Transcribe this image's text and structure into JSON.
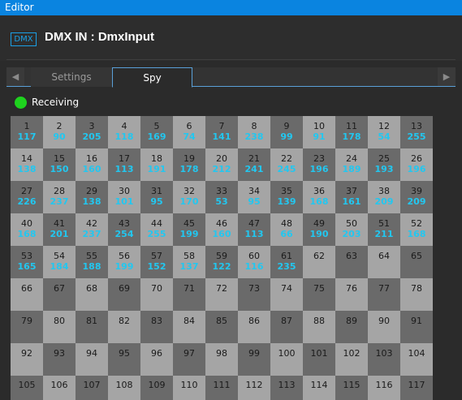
{
  "window": {
    "title": "Editor"
  },
  "header": {
    "badge": "DMX",
    "title": "DMX IN : DmxInput"
  },
  "tabs": {
    "left_arrow": "◀",
    "right_arrow": "▶",
    "settings": "Settings",
    "spy": "Spy",
    "active": "Spy"
  },
  "status": {
    "label": "Receiving",
    "color": "#1ed21e"
  },
  "colors": {
    "accent": "#0a84e0",
    "value": "#22c7f0",
    "cell_light": "#a5a5a5",
    "cell_dark": "#6a6a6a"
  },
  "channels": [
    {
      "ch": "1",
      "val": "117"
    },
    {
      "ch": "2",
      "val": "90"
    },
    {
      "ch": "3",
      "val": "205"
    },
    {
      "ch": "4",
      "val": "118"
    },
    {
      "ch": "5",
      "val": "169"
    },
    {
      "ch": "6",
      "val": "74"
    },
    {
      "ch": "7",
      "val": "141"
    },
    {
      "ch": "8",
      "val": "238"
    },
    {
      "ch": "9",
      "val": "99"
    },
    {
      "ch": "10",
      "val": "91"
    },
    {
      "ch": "11",
      "val": "178"
    },
    {
      "ch": "12",
      "val": "54"
    },
    {
      "ch": "13",
      "val": "255"
    },
    {
      "ch": "14",
      "val": "138"
    },
    {
      "ch": "15",
      "val": "150"
    },
    {
      "ch": "16",
      "val": "160"
    },
    {
      "ch": "17",
      "val": "113"
    },
    {
      "ch": "18",
      "val": "191"
    },
    {
      "ch": "19",
      "val": "178"
    },
    {
      "ch": "20",
      "val": "212"
    },
    {
      "ch": "21",
      "val": "241"
    },
    {
      "ch": "22",
      "val": "245"
    },
    {
      "ch": "23",
      "val": "196"
    },
    {
      "ch": "24",
      "val": "189"
    },
    {
      "ch": "25",
      "val": "193"
    },
    {
      "ch": "26",
      "val": "196"
    },
    {
      "ch": "27",
      "val": "226"
    },
    {
      "ch": "28",
      "val": "237"
    },
    {
      "ch": "29",
      "val": "138"
    },
    {
      "ch": "30",
      "val": "101"
    },
    {
      "ch": "31",
      "val": "95"
    },
    {
      "ch": "32",
      "val": "170"
    },
    {
      "ch": "33",
      "val": "53"
    },
    {
      "ch": "34",
      "val": "95"
    },
    {
      "ch": "35",
      "val": "139"
    },
    {
      "ch": "36",
      "val": "168"
    },
    {
      "ch": "37",
      "val": "161"
    },
    {
      "ch": "38",
      "val": "209"
    },
    {
      "ch": "39",
      "val": "209"
    },
    {
      "ch": "40",
      "val": "168"
    },
    {
      "ch": "41",
      "val": "201"
    },
    {
      "ch": "42",
      "val": "237"
    },
    {
      "ch": "43",
      "val": "254"
    },
    {
      "ch": "44",
      "val": "255"
    },
    {
      "ch": "45",
      "val": "199"
    },
    {
      "ch": "46",
      "val": "160"
    },
    {
      "ch": "47",
      "val": "113"
    },
    {
      "ch": "48",
      "val": "66"
    },
    {
      "ch": "49",
      "val": "190"
    },
    {
      "ch": "50",
      "val": "203"
    },
    {
      "ch": "51",
      "val": "211"
    },
    {
      "ch": "52",
      "val": "168"
    },
    {
      "ch": "53",
      "val": "165"
    },
    {
      "ch": "54",
      "val": "184"
    },
    {
      "ch": "55",
      "val": "188"
    },
    {
      "ch": "56",
      "val": "199"
    },
    {
      "ch": "57",
      "val": "152"
    },
    {
      "ch": "58",
      "val": "137"
    },
    {
      "ch": "59",
      "val": "122"
    },
    {
      "ch": "60",
      "val": "116"
    },
    {
      "ch": "61",
      "val": "235"
    },
    {
      "ch": "62",
      "val": ""
    },
    {
      "ch": "63",
      "val": ""
    },
    {
      "ch": "64",
      "val": ""
    },
    {
      "ch": "65",
      "val": ""
    },
    {
      "ch": "66",
      "val": ""
    },
    {
      "ch": "67",
      "val": ""
    },
    {
      "ch": "68",
      "val": ""
    },
    {
      "ch": "69",
      "val": ""
    },
    {
      "ch": "70",
      "val": ""
    },
    {
      "ch": "71",
      "val": ""
    },
    {
      "ch": "72",
      "val": ""
    },
    {
      "ch": "73",
      "val": ""
    },
    {
      "ch": "74",
      "val": ""
    },
    {
      "ch": "75",
      "val": ""
    },
    {
      "ch": "76",
      "val": ""
    },
    {
      "ch": "77",
      "val": ""
    },
    {
      "ch": "78",
      "val": ""
    },
    {
      "ch": "79",
      "val": ""
    },
    {
      "ch": "80",
      "val": ""
    },
    {
      "ch": "81",
      "val": ""
    },
    {
      "ch": "82",
      "val": ""
    },
    {
      "ch": "83",
      "val": ""
    },
    {
      "ch": "84",
      "val": ""
    },
    {
      "ch": "85",
      "val": ""
    },
    {
      "ch": "86",
      "val": ""
    },
    {
      "ch": "87",
      "val": ""
    },
    {
      "ch": "88",
      "val": ""
    },
    {
      "ch": "89",
      "val": ""
    },
    {
      "ch": "90",
      "val": ""
    },
    {
      "ch": "91",
      "val": ""
    },
    {
      "ch": "92",
      "val": ""
    },
    {
      "ch": "93",
      "val": ""
    },
    {
      "ch": "94",
      "val": ""
    },
    {
      "ch": "95",
      "val": ""
    },
    {
      "ch": "96",
      "val": ""
    },
    {
      "ch": "97",
      "val": ""
    },
    {
      "ch": "98",
      "val": ""
    },
    {
      "ch": "99",
      "val": ""
    },
    {
      "ch": "100",
      "val": ""
    },
    {
      "ch": "101",
      "val": ""
    },
    {
      "ch": "102",
      "val": ""
    },
    {
      "ch": "103",
      "val": ""
    },
    {
      "ch": "104",
      "val": ""
    },
    {
      "ch": "105",
      "val": ""
    },
    {
      "ch": "106",
      "val": ""
    },
    {
      "ch": "107",
      "val": ""
    },
    {
      "ch": "108",
      "val": ""
    },
    {
      "ch": "109",
      "val": ""
    },
    {
      "ch": "110",
      "val": ""
    },
    {
      "ch": "111",
      "val": ""
    },
    {
      "ch": "112",
      "val": ""
    },
    {
      "ch": "113",
      "val": ""
    },
    {
      "ch": "114",
      "val": ""
    },
    {
      "ch": "115",
      "val": ""
    },
    {
      "ch": "116",
      "val": ""
    },
    {
      "ch": "117",
      "val": ""
    }
  ]
}
